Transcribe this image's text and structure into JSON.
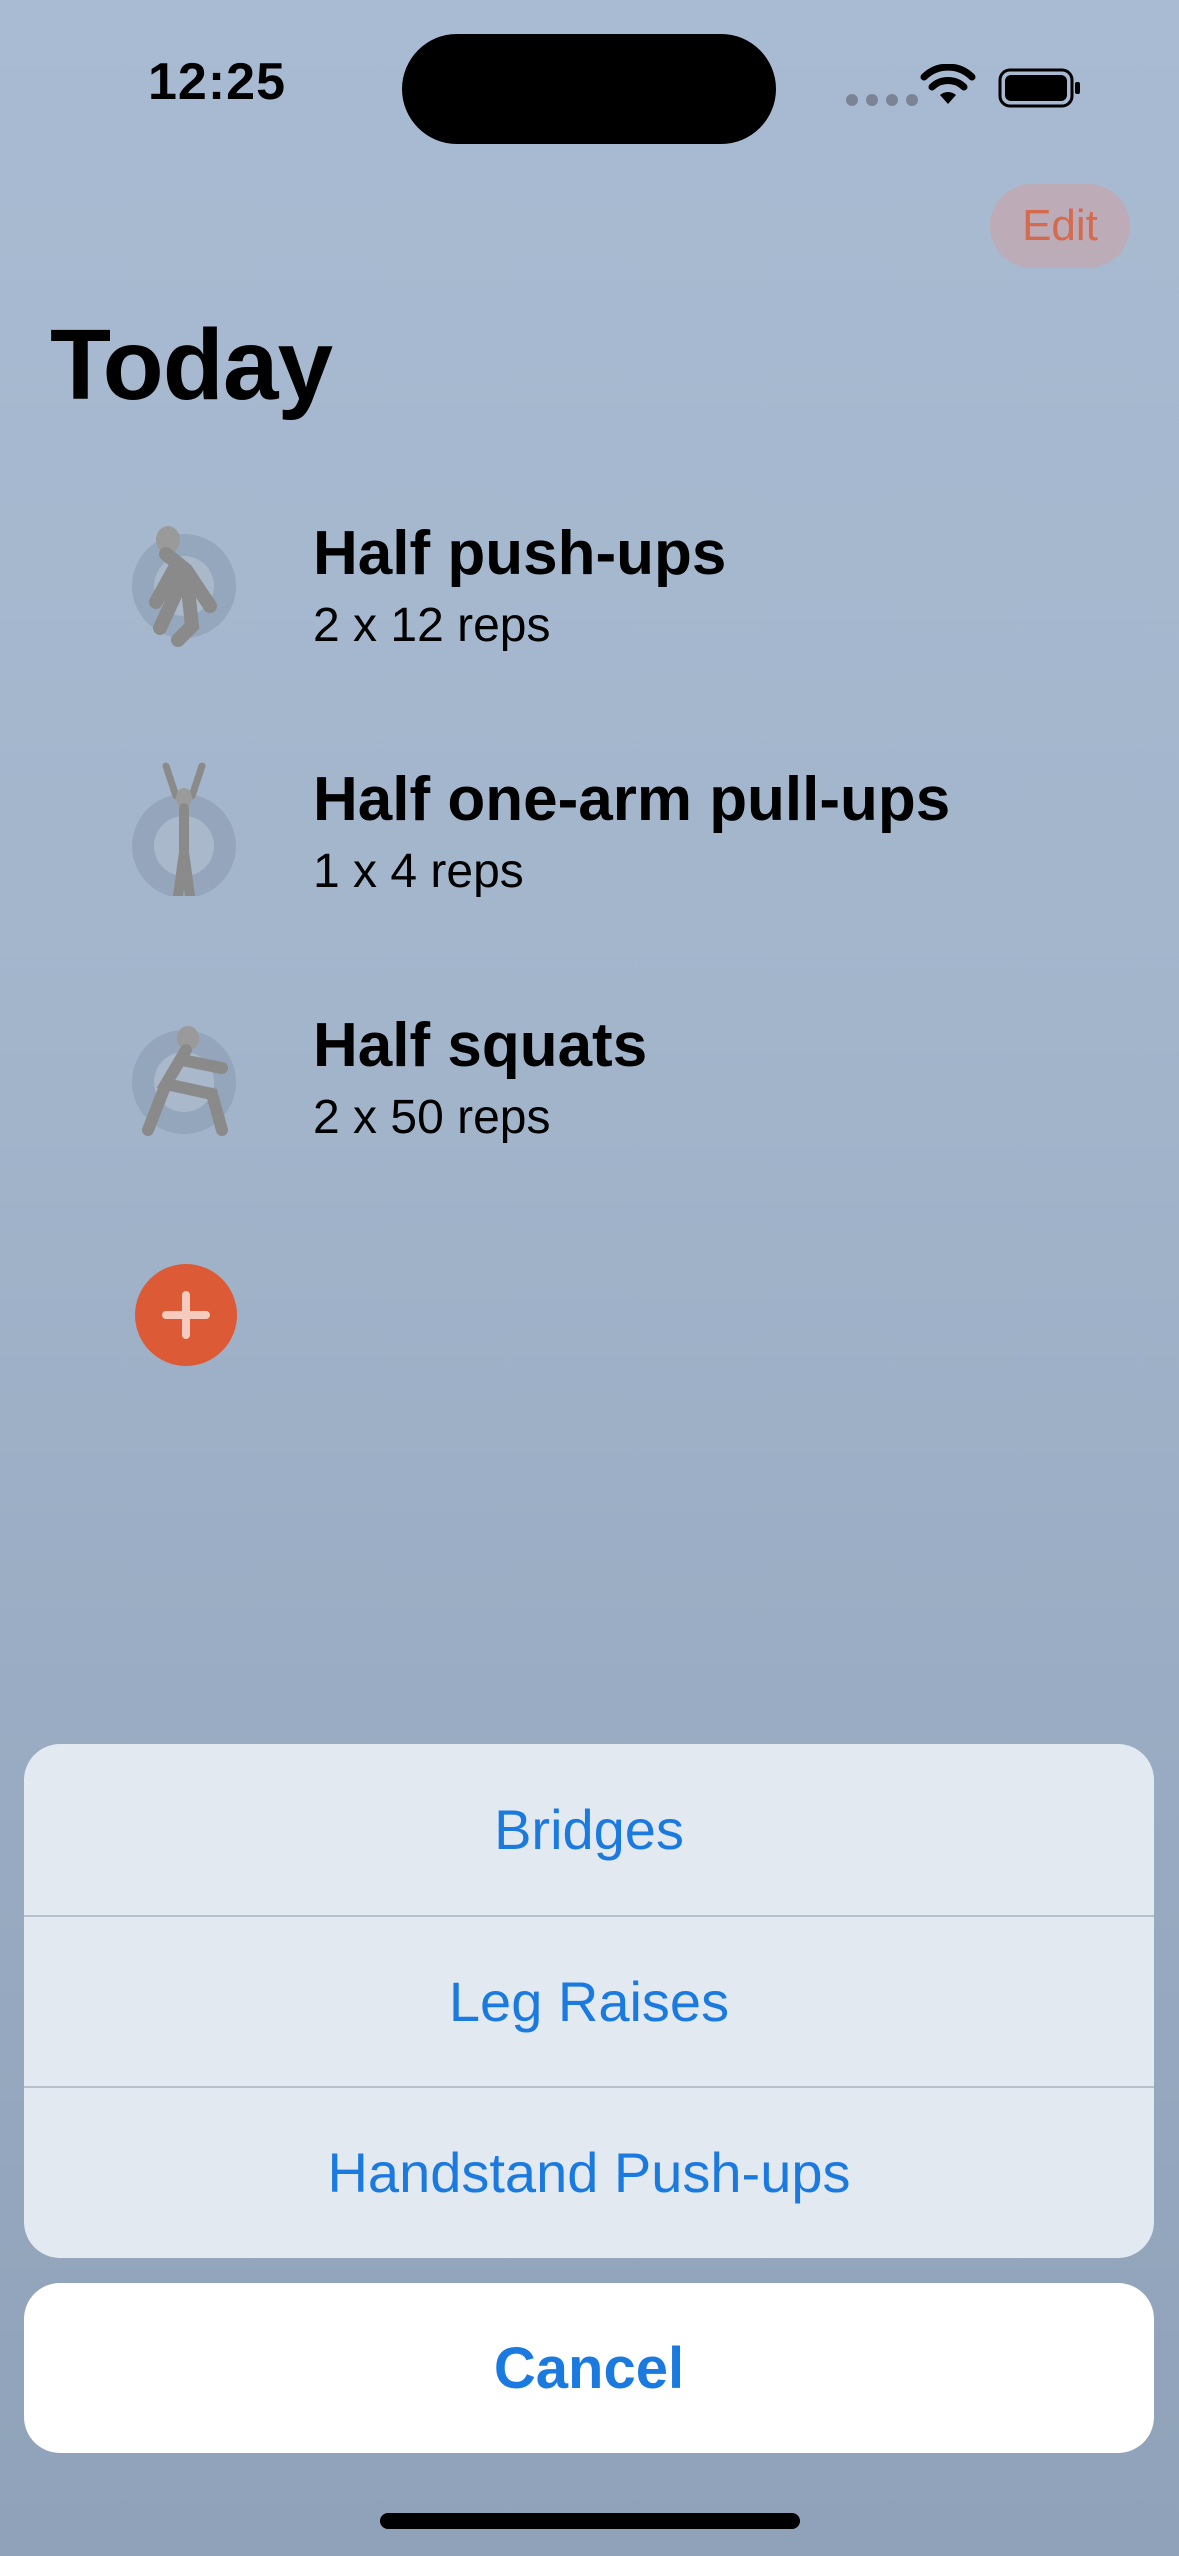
{
  "status_bar": {
    "time": "12:25"
  },
  "header": {
    "edit_label": "Edit",
    "title": "Today"
  },
  "exercises": [
    {
      "name": "Half push-ups",
      "detail": "2 x 12 reps",
      "icon": "pushup-figure-icon"
    },
    {
      "name": "Half one-arm pull-ups",
      "detail": "1 x 4 reps",
      "icon": "pullup-figure-icon"
    },
    {
      "name": "Half squats",
      "detail": "2 x 50 reps",
      "icon": "squat-figure-icon"
    }
  ],
  "add_button": {
    "icon": "plus-icon"
  },
  "action_sheet": {
    "options": [
      "Bridges",
      "Leg Raises",
      "Handstand Push-ups"
    ],
    "cancel_label": "Cancel"
  },
  "colors": {
    "accent": "#dc5a35",
    "link_blue": "#1a7ae0",
    "edit_text": "#d46a4e"
  }
}
